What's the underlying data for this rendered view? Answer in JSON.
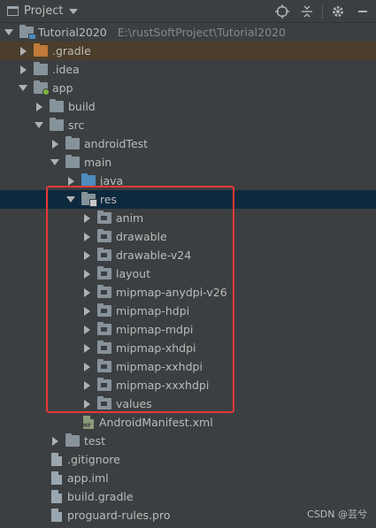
{
  "toolbar": {
    "title": "Project",
    "icons": [
      "crosshair-icon",
      "collapse-icon",
      "gear-icon",
      "minimize-icon"
    ]
  },
  "tree": {
    "root": {
      "label": "Tutorial2020",
      "path": "E:\\rustSoftProject\\Tutorial2020"
    },
    "gradle_dir": ".gradle",
    "idea_dir": ".idea",
    "app": "app",
    "build": "build",
    "src": "src",
    "androidTest": "androidTest",
    "main": "main",
    "java": "java",
    "res": "res",
    "res_children": [
      "anim",
      "drawable",
      "drawable-v24",
      "layout",
      "mipmap-anydpi-v26",
      "mipmap-hdpi",
      "mipmap-mdpi",
      "mipmap-xhdpi",
      "mipmap-xxhdpi",
      "mipmap-xxxhdpi",
      "values"
    ],
    "manifest": "AndroidManifest.xml",
    "test": "test",
    "gitignore": ".gitignore",
    "app_iml": "app.iml",
    "build_gradle": "build.gradle",
    "proguard": "proguard-rules.pro"
  },
  "watermark": "CSDN @芸兮",
  "colors": {
    "highlight_box": "#e53935",
    "selected_row": "#0d293e",
    "excluded_row": "#4b3e2a"
  }
}
